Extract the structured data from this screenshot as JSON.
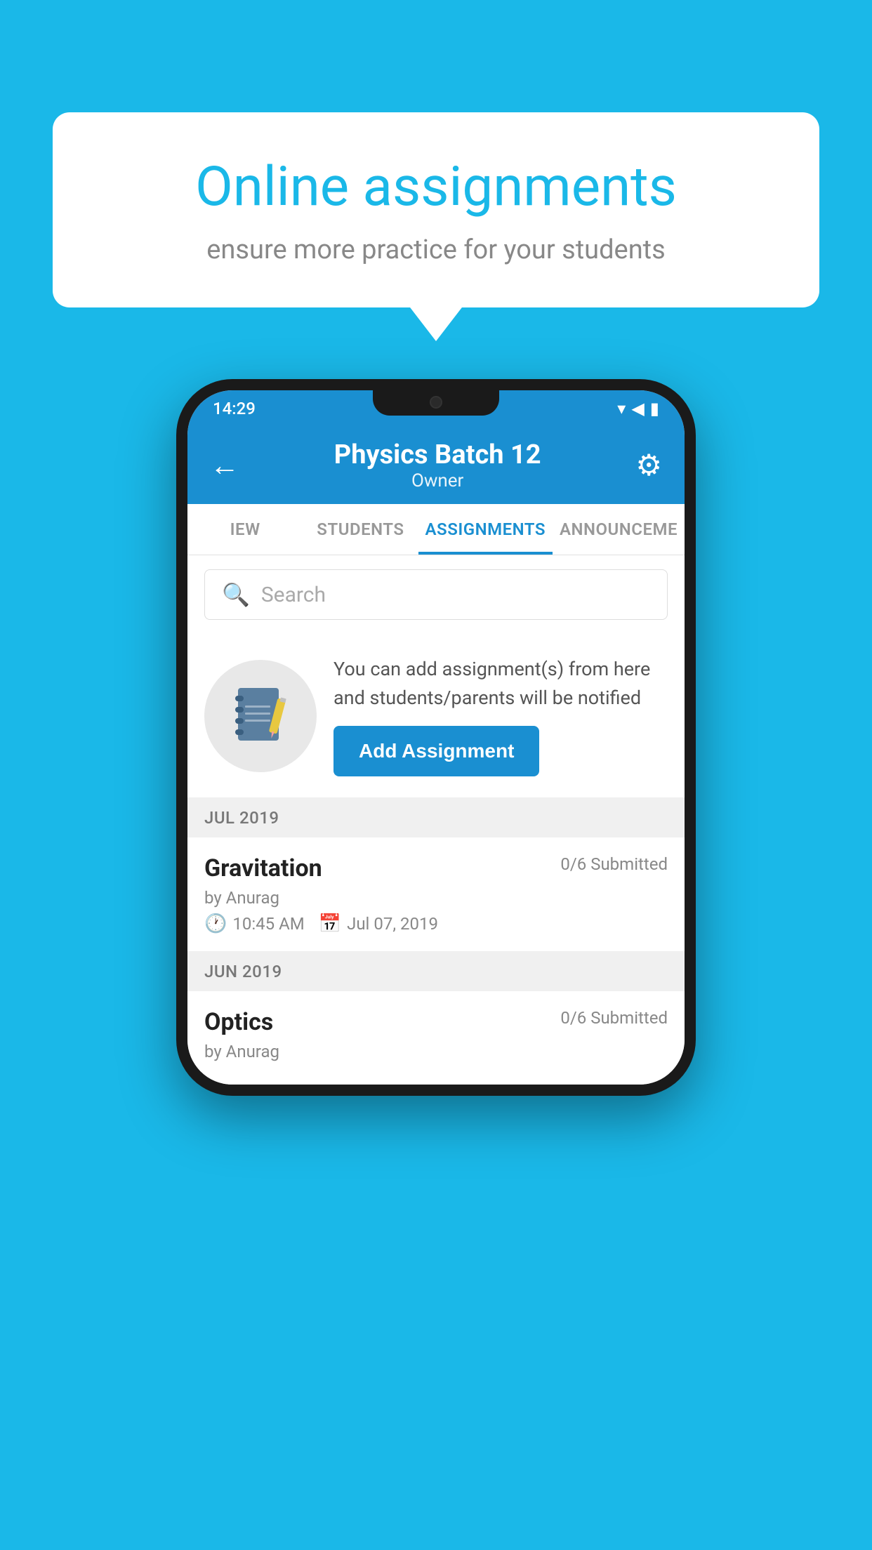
{
  "background_color": "#1ab8e8",
  "speech_bubble": {
    "title": "Online assignments",
    "subtitle": "ensure more practice for your students"
  },
  "status_bar": {
    "time": "14:29",
    "wifi": "▾",
    "signal": "▲",
    "battery": "▮"
  },
  "app_bar": {
    "title": "Physics Batch 12",
    "subtitle": "Owner",
    "back_label": "←",
    "settings_label": "⚙"
  },
  "tabs": [
    {
      "label": "IEW",
      "active": false
    },
    {
      "label": "STUDENTS",
      "active": false
    },
    {
      "label": "ASSIGNMENTS",
      "active": true
    },
    {
      "label": "ANNOUNCEMENTS",
      "active": false
    }
  ],
  "search": {
    "placeholder": "Search"
  },
  "promo": {
    "description": "You can add assignment(s) from here and students/parents will be notified",
    "button_label": "Add Assignment"
  },
  "sections": [
    {
      "header": "JUL 2019",
      "assignments": [
        {
          "name": "Gravitation",
          "submitted": "0/6 Submitted",
          "by": "by Anurag",
          "time": "10:45 AM",
          "date": "Jul 07, 2019"
        }
      ]
    },
    {
      "header": "JUN 2019",
      "assignments": [
        {
          "name": "Optics",
          "submitted": "0/6 Submitted",
          "by": "by Anurag",
          "time": "",
          "date": ""
        }
      ]
    }
  ]
}
